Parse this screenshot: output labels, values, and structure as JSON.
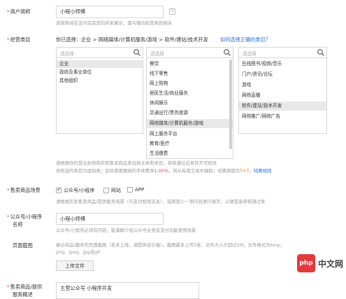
{
  "merchant_name": {
    "label": "商户简称",
    "value": "小程小师傅",
    "hint": "该简称将在支付完成页向买家展示，需与微信经营类目相关"
  },
  "category": {
    "label": "经营类目",
    "selected_prefix": "你已选择：",
    "selected_path": "企业 > 网络媒体/计算机服务/游戏 > 软件/建站/技术开发",
    "help_link": "如何选择正确的类目？",
    "search_placeholder": "请选择",
    "col1": [
      "企业",
      "政府及事业单位",
      "其他组织"
    ],
    "col2": [
      "餐饮",
      "线下零售",
      "网上购物",
      "居民生活/商业服务",
      "休闲娱乐",
      "交通出行/票务旅游",
      "网络媒体/计算机服务/游戏",
      "网上服务平台",
      "教育/医疗",
      "生活缴费"
    ],
    "col3": [
      "在线图书/视频/音乐",
      "门户/资讯/论坛",
      "游戏",
      "网络直播",
      "软件/建站/技术开发",
      "网络推广/网络广告"
    ],
    "hint1": "请根据你的营业执照和实际售卖商品来选择主体和类目，审核通过后类目不可修改",
    "hint2_a": "你所选的类目为虚拟类；后续需要缴纳的手续费率",
    "hint2_rate": "1.00%",
    "hint2_b": "，将从每笔交易中抽取；结算周期为",
    "hint2_cycle": "T+7",
    "hint2_c": "。",
    "hint2_link": "结算规则"
  },
  "scene": {
    "label": "售卖商品场景",
    "options": [
      "公众号/小程序",
      "网站",
      "APP"
    ],
    "hint": "请根据实际售卖商品/提供服务场景（与支付权限无关），选择至少一项内容进行填写，以便提高审核通过率"
  },
  "mp_name": {
    "label_line1": "公众号/小程序",
    "label_line2": "名称",
    "value": "小程小师傅",
    "hint": "公众号/小程序必须有内容，能满解介绍公众号业务及支付功能使用场景"
  },
  "screenshot": {
    "label": "页面截图",
    "hint_line1": "展示商品/服务的页面截图（若未上线，请提供设计稿）。截图最多上传5张，文件大小不超过2M，文件格式为bmp、",
    "hint_line2": "png、jpeg、jpg或gif",
    "upload_label": "上传文件"
  },
  "desc": {
    "label_line1": "售卖商品/提供",
    "label_line2": "服务概述",
    "value": "主营公众号 小程序开发"
  },
  "watermark": {
    "logo": "php",
    "text": "中文网"
  }
}
